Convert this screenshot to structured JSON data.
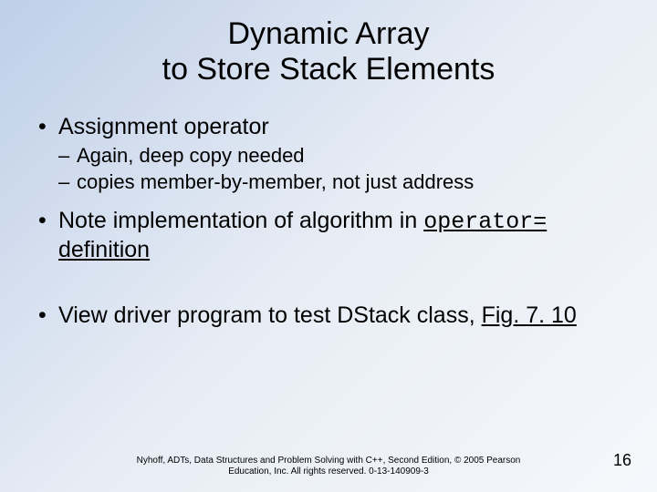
{
  "title_line1": "Dynamic Array",
  "title_line2": "to Store Stack Elements",
  "bullets": {
    "b1": "Assignment operator",
    "b1_sub1": "Again, deep copy needed",
    "b1_sub2": "copies member-by-member, not just address",
    "b2_pre": "Note implementation of algorithm in ",
    "b2_code": "operator=",
    "b2_link": " definition",
    "b3_pre": "View driver program to test DStack class, ",
    "b3_link": "Fig. 7. 10"
  },
  "footer_line1": "Nyhoff, ADTs, Data Structures and Problem Solving with C++, Second Edition, © 2005 Pearson",
  "footer_line2": "Education, Inc. All rights reserved. 0-13-140909-3",
  "page_number": "16"
}
